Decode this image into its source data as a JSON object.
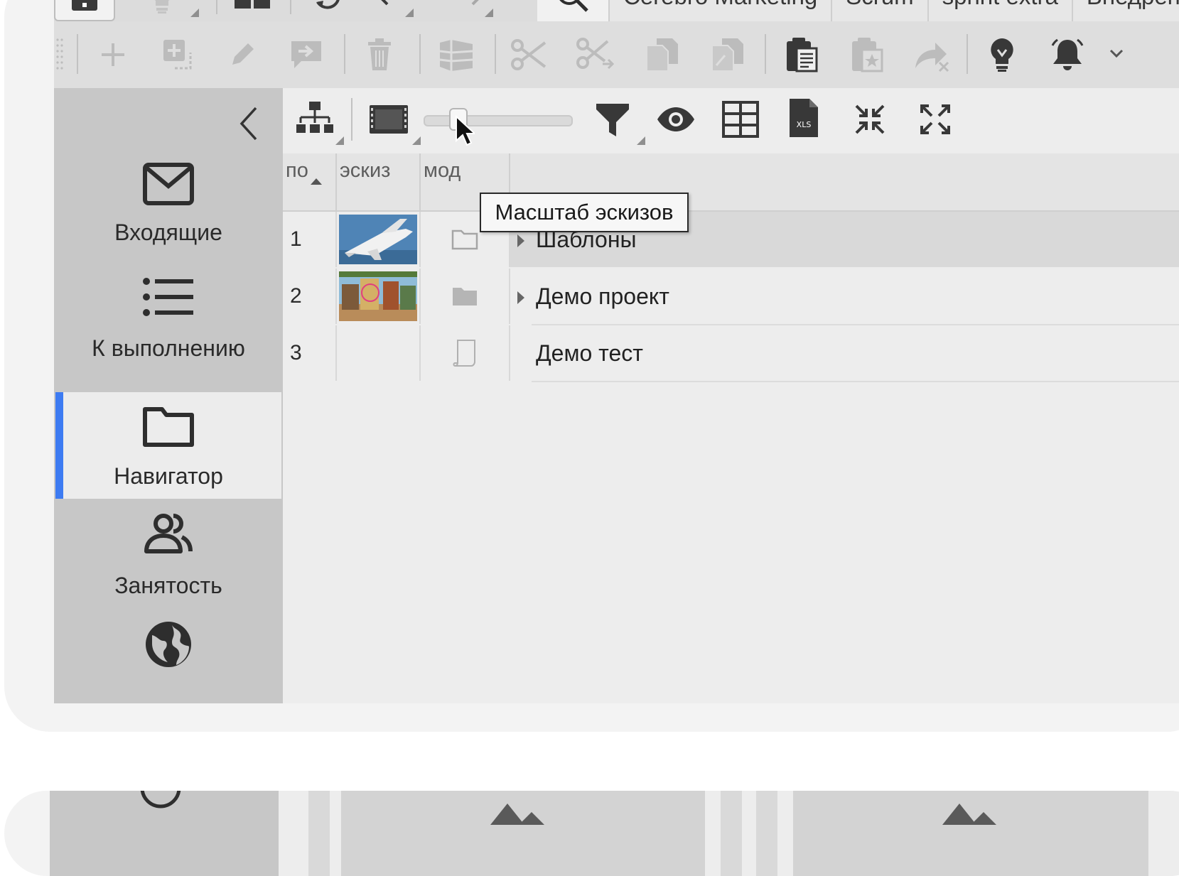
{
  "tabs": [
    "Cerebro Marketing",
    "Scrum",
    "sprint extra",
    "Внедрение"
  ],
  "sidebar": {
    "collapse_icon": "chevron-left-icon",
    "items": [
      {
        "label": "Входящие",
        "icon": "envelope-icon"
      },
      {
        "label": "К выполнению",
        "icon": "list-icon"
      },
      {
        "label": "Навигатор",
        "icon": "folder-icon",
        "active": true
      },
      {
        "label": "Занятость",
        "icon": "users-icon"
      },
      {
        "label": "",
        "icon": "globe-icon"
      }
    ]
  },
  "table": {
    "columns": [
      "по",
      "эскиз",
      "мод"
    ],
    "rows": [
      {
        "num": "1",
        "name": "Шаблоны",
        "thumb": "space-shuttle",
        "type_icon": "folder-outline-icon",
        "expandable": true,
        "selected": true
      },
      {
        "num": "2",
        "name": "Демо проект",
        "thumb": "fantasy-street",
        "type_icon": "folder-filled-icon",
        "expandable": true,
        "selected": false
      },
      {
        "num": "3",
        "name": "Демо тест",
        "thumb": "",
        "type_icon": "document-icon",
        "expandable": false,
        "selected": false
      }
    ]
  },
  "thumbnail_scale": {
    "value": 0.2
  },
  "tooltip": "Масштаб эскизов",
  "colors": {
    "accent": "#3d7bf2",
    "sidebar_bg": "#c7c7c7",
    "selected_row": "#d9d9d9"
  }
}
